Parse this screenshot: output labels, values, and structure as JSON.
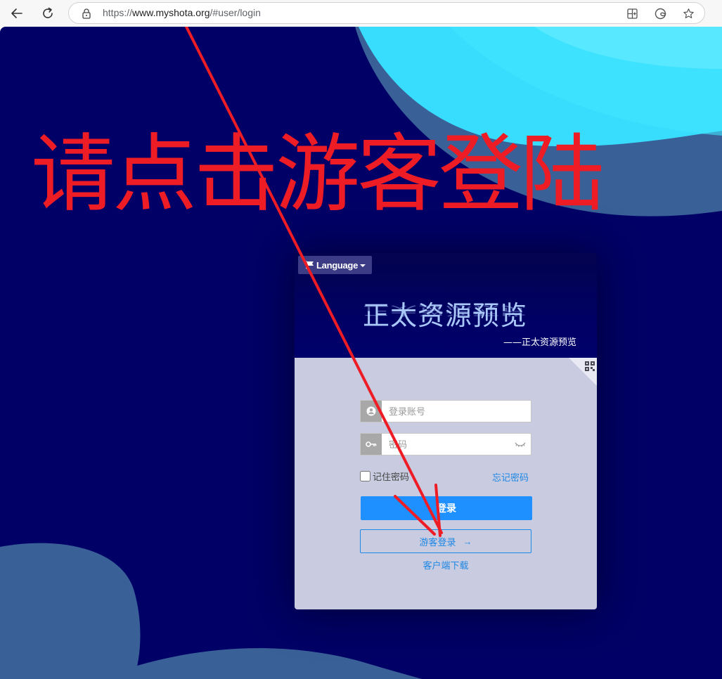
{
  "browser": {
    "url_prefix": "https://",
    "url_host": "www.myshota.org",
    "url_path": "/#user/login",
    "icons": [
      "back-icon",
      "reload-icon",
      "lock-icon",
      "split-screen-icon",
      "edge-icon",
      "favorite-star-icon"
    ]
  },
  "overlay": {
    "instruction": "请点击游客登陆",
    "instruction_color": "#ee1c25"
  },
  "card": {
    "language_label": "Language",
    "brand_title": "正太资源预览",
    "brand_subtitle": "——正太资源预览",
    "username_placeholder": "登录账号",
    "password_placeholder": "密码",
    "remember_label": "记住密码",
    "forgot_label": "忘记密码",
    "login_label": "登录",
    "guest_label": "游客登录",
    "guest_arrow": "→",
    "download_label": "客户端下载"
  },
  "colors": {
    "page_bg": "#000066",
    "card_body_bg": "#c9cbe0",
    "primary": "#1e90ff",
    "link": "#1e88e5",
    "wave_cyan": "#38dcfc",
    "wave_blue": "#3a6098"
  }
}
